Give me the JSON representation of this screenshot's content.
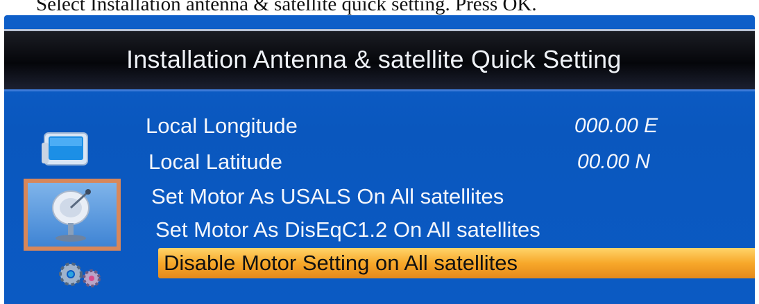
{
  "caption": "Select Installation antenna & satellite quick setting. Press OK.",
  "title": "Installation Antenna & satellite Quick Setting",
  "icons": {
    "monitor": "tv-monitor-icon",
    "satellite": "satellite-dish-icon",
    "settings": "gears-icon"
  },
  "menu": {
    "items": [
      {
        "label": "Local Longitude",
        "value": "000.00 E"
      },
      {
        "label": "Local Latitude",
        "value": "00.00 N"
      },
      {
        "label": "Set Motor As USALS On All satellites"
      },
      {
        "label": "Set Motor As DisEqC1.2 On All satellites"
      },
      {
        "label": "Disable Motor Setting on All satellites",
        "selected": true
      }
    ]
  },
  "colors": {
    "panel": "#0b5ac3",
    "title_bar": "#05060a",
    "highlight": "#f7a82a",
    "active_icon_border": "#d8875a"
  }
}
